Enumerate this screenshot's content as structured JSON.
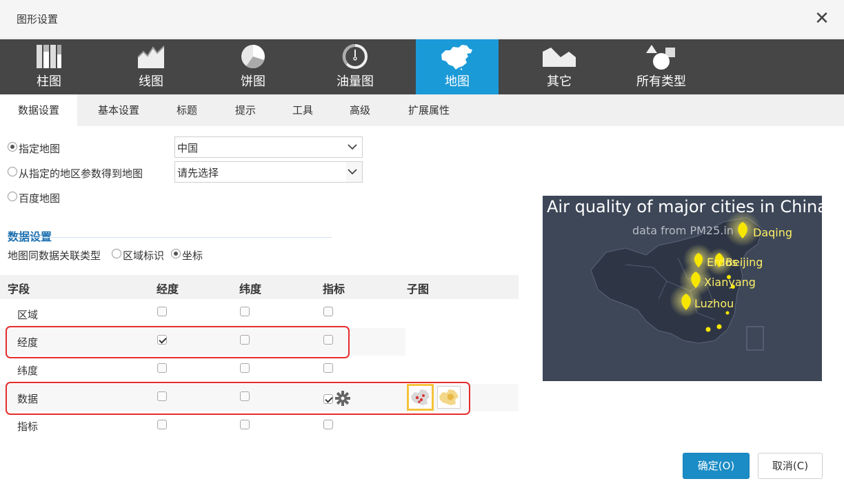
{
  "dialog": {
    "title": "图形设置",
    "close_symbol": "✕"
  },
  "chart_types": [
    {
      "label": "柱图",
      "icon": "bar-chart-icon"
    },
    {
      "label": "线图",
      "icon": "line-chart-icon"
    },
    {
      "label": "饼图",
      "icon": "pie-chart-icon"
    },
    {
      "label": "油量图",
      "icon": "gauge-icon"
    },
    {
      "label": "地图",
      "icon": "china-map-icon",
      "active": true
    },
    {
      "label": "其它",
      "icon": "other-chart-icon"
    },
    {
      "label": "所有类型",
      "icon": "shapes-icon"
    }
  ],
  "sub_tabs": [
    "数据设置",
    "基本设置",
    "标题",
    "提示",
    "工具",
    "高级",
    "扩展属性"
  ],
  "map_source": {
    "opt_specified": "指定地图",
    "opt_from_param": "从指定的地区参数得到地图",
    "opt_baidu": "百度地图",
    "specified_value": "中国",
    "param_placeholder": "请先选择",
    "selected": "指定地图"
  },
  "data_settings": {
    "section_title": "数据设置",
    "relation_label": "地图同数据关联类型",
    "opt_region": "区域标识",
    "opt_coord": "坐标",
    "selected": "坐标"
  },
  "table": {
    "headers": [
      "字段",
      "经度",
      "纬度",
      "指标",
      "子图"
    ],
    "rows": [
      {
        "field": "区域",
        "lng": false,
        "lat": false,
        "ind": false
      },
      {
        "field": "经度",
        "lng": true,
        "lat": false,
        "ind": false
      },
      {
        "field": "纬度",
        "lng": false,
        "lat": false,
        "ind": false
      },
      {
        "field": "数据",
        "lng": false,
        "lat": false,
        "ind": true
      },
      {
        "field": "指标",
        "lng": false,
        "lat": false,
        "ind": false
      }
    ]
  },
  "preview": {
    "title": "Air quality of major cities in China",
    "subtitle": "data from PM25.in",
    "cities": [
      "Daqing",
      "Erdos",
      "Beijing",
      "Xianyang",
      "Luzhou"
    ],
    "bg_color": "#3d4758",
    "marker_color": "#f7e600"
  },
  "buttons": {
    "ok": "确定(O)",
    "cancel": "取消(C)"
  },
  "colors": {
    "accent": "#1b9ad8",
    "tabbar": "#464646",
    "highlight": "#e52c2c",
    "selected_thumb": "#f5c33b"
  }
}
